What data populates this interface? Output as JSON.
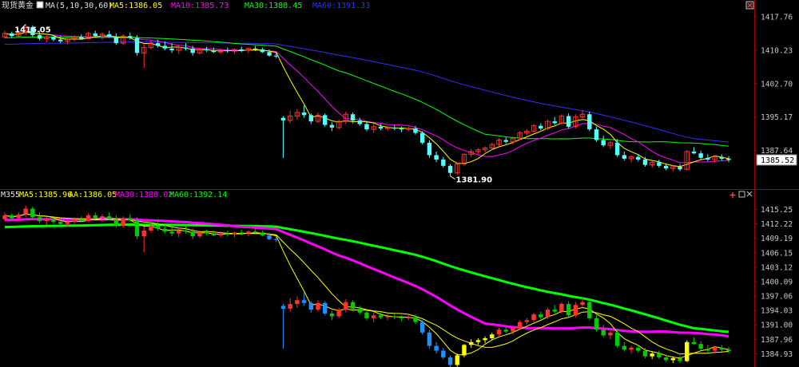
{
  "colors": {
    "background": "#000000",
    "up_candle": "#ff3232",
    "down_candle_top": "#54ffff",
    "down_candle_bottom": "#00cc00",
    "ma5": "#ffff00",
    "ma10": "#ff00ff",
    "ma30": "#00ff00",
    "ma60": "#3030ff",
    "axis_border": "#a00000",
    "axis_text": "#c8c8c8"
  },
  "top_panel": {
    "title": "现货黄金",
    "ma_params": "MA(5,10,30,60)",
    "ma5": "MA5:1386.05",
    "ma10": "MA10:1385.73",
    "ma30": "MA30:1388.45",
    "ma60": "MA60:1391.33",
    "high_annotation": "1416.05",
    "low_annotation": "1381.90",
    "current_price": "1385.52",
    "corner_icon": "close-box-icon"
  },
  "bottom_panel": {
    "indicator_name": "M355",
    "ma5": "MA5:1385.96",
    "aa": "AA:1386.05",
    "ma30": "MA30:1388.02",
    "ma60": "MA60:1392.14",
    "corner_icons": [
      "plus-icon",
      "restore-icon",
      "close-icon"
    ]
  },
  "chart_data": [
    {
      "type": "candlestick",
      "panel": "top",
      "title": "现货黄金",
      "yaxis_ticks": [
        "1417.76",
        "1410.23",
        "1402.70",
        "1395.17",
        "1387.64"
      ],
      "ylim": [
        1379.5,
        1419.0
      ],
      "series": [
        {
          "name": "MA5",
          "value": 1386.05
        },
        {
          "name": "MA10",
          "value": 1385.73
        },
        {
          "name": "MA30",
          "value": 1388.45
        },
        {
          "name": "MA60",
          "value": 1391.33
        }
      ],
      "high": 1416.05,
      "low": 1381.9,
      "last": 1385.52,
      "candles_ohlc": [
        [
          1413.2,
          1414.6,
          1412.8,
          1414.0
        ],
        [
          1414.0,
          1414.4,
          1413.0,
          1413.4
        ],
        [
          1413.4,
          1414.6,
          1413.2,
          1414.2
        ],
        [
          1414.2,
          1416.05,
          1413.6,
          1415.4
        ],
        [
          1415.4,
          1415.8,
          1413.2,
          1413.6
        ],
        [
          1413.6,
          1414.6,
          1412.4,
          1412.8
        ],
        [
          1412.8,
          1413.6,
          1412.0,
          1413.2
        ],
        [
          1413.2,
          1413.6,
          1412.2,
          1412.6
        ],
        [
          1412.6,
          1413.4,
          1411.8,
          1412.2
        ],
        [
          1412.2,
          1413.0,
          1411.6,
          1412.6
        ],
        [
          1412.6,
          1413.6,
          1412.2,
          1413.2
        ],
        [
          1413.2,
          1413.8,
          1412.6,
          1412.8
        ],
        [
          1412.8,
          1414.4,
          1412.6,
          1414.0
        ],
        [
          1414.0,
          1414.6,
          1413.2,
          1413.4
        ],
        [
          1413.4,
          1414.2,
          1412.6,
          1413.8
        ],
        [
          1413.8,
          1414.6,
          1413.0,
          1413.2
        ],
        [
          1413.2,
          1414.0,
          1411.4,
          1411.8
        ],
        [
          1411.8,
          1413.8,
          1411.4,
          1413.4
        ],
        [
          1413.4,
          1414.2,
          1412.6,
          1413.0
        ],
        [
          1413.0,
          1413.6,
          1409.0,
          1409.6
        ],
        [
          1409.6,
          1411.6,
          1406.2,
          1410.8
        ],
        [
          1410.8,
          1412.4,
          1410.4,
          1411.8
        ],
        [
          1411.8,
          1412.6,
          1410.8,
          1411.2
        ],
        [
          1411.2,
          1412.2,
          1410.2,
          1410.6
        ],
        [
          1410.6,
          1411.8,
          1409.6,
          1410.2
        ],
        [
          1410.2,
          1411.4,
          1409.4,
          1410.8
        ],
        [
          1410.8,
          1411.8,
          1410.2,
          1410.6
        ],
        [
          1410.6,
          1411.2,
          1409.0,
          1409.6
        ],
        [
          1409.6,
          1410.8,
          1409.2,
          1410.4
        ],
        [
          1410.4,
          1411.0,
          1409.8,
          1410.2
        ],
        [
          1410.2,
          1410.8,
          1409.6,
          1409.8
        ],
        [
          1409.8,
          1410.6,
          1409.4,
          1410.2
        ],
        [
          1410.2,
          1410.8,
          1409.6,
          1410.0
        ],
        [
          1410.0,
          1410.6,
          1409.4,
          1410.4
        ],
        [
          1410.4,
          1411.0,
          1409.8,
          1410.2
        ],
        [
          1410.2,
          1410.8,
          1409.6,
          1410.6
        ],
        [
          1410.6,
          1411.2,
          1410.0,
          1410.4
        ],
        [
          1410.4,
          1410.8,
          1409.6,
          1409.8
        ],
        [
          1409.8,
          1410.4,
          1408.8,
          1409.0
        ],
        [
          1409.0,
          1409.6,
          1408.4,
          1408.8
        ],
        [
          1395.0,
          1395.4,
          1386.0,
          1394.4
        ],
        [
          1394.4,
          1396.6,
          1393.8,
          1395.4
        ],
        [
          1395.4,
          1397.0,
          1394.6,
          1396.2
        ],
        [
          1396.2,
          1397.8,
          1395.0,
          1395.6
        ],
        [
          1395.6,
          1396.0,
          1393.6,
          1394.2
        ],
        [
          1394.2,
          1396.2,
          1393.8,
          1395.6
        ],
        [
          1395.6,
          1396.0,
          1393.0,
          1393.4
        ],
        [
          1393.4,
          1394.0,
          1392.0,
          1392.8
        ],
        [
          1392.8,
          1394.6,
          1392.4,
          1394.2
        ],
        [
          1394.2,
          1396.4,
          1393.6,
          1395.8
        ],
        [
          1395.8,
          1396.2,
          1393.8,
          1394.4
        ],
        [
          1394.4,
          1395.0,
          1393.2,
          1393.6
        ],
        [
          1393.6,
          1394.2,
          1392.0,
          1392.4
        ],
        [
          1392.4,
          1393.6,
          1391.6,
          1393.0
        ],
        [
          1393.0,
          1393.6,
          1392.2,
          1392.6
        ],
        [
          1392.6,
          1393.2,
          1392.0,
          1392.8
        ],
        [
          1392.8,
          1393.4,
          1392.2,
          1392.6
        ],
        [
          1392.6,
          1393.0,
          1391.8,
          1392.4
        ],
        [
          1392.4,
          1393.0,
          1392.0,
          1392.6
        ],
        [
          1392.6,
          1393.2,
          1391.2,
          1391.6
        ],
        [
          1391.6,
          1392.0,
          1389.0,
          1389.4
        ],
        [
          1389.4,
          1390.0,
          1386.0,
          1386.6
        ],
        [
          1386.6,
          1387.4,
          1385.0,
          1385.6
        ],
        [
          1385.6,
          1386.2,
          1383.8,
          1384.2
        ],
        [
          1384.2,
          1384.6,
          1381.9,
          1382.6
        ],
        [
          1382.6,
          1385.0,
          1382.2,
          1384.6
        ],
        [
          1384.6,
          1387.0,
          1384.2,
          1386.8
        ],
        [
          1386.8,
          1388.0,
          1386.2,
          1387.4
        ],
        [
          1387.4,
          1388.2,
          1386.8,
          1387.8
        ],
        [
          1387.8,
          1388.6,
          1387.2,
          1388.2
        ],
        [
          1388.2,
          1389.4,
          1387.8,
          1389.0
        ],
        [
          1389.0,
          1390.4,
          1388.6,
          1390.0
        ],
        [
          1390.0,
          1390.6,
          1389.2,
          1389.6
        ],
        [
          1389.6,
          1390.8,
          1389.0,
          1390.4
        ],
        [
          1390.4,
          1392.0,
          1390.0,
          1391.6
        ],
        [
          1391.6,
          1392.4,
          1391.0,
          1392.0
        ],
        [
          1392.0,
          1393.6,
          1391.6,
          1393.2
        ],
        [
          1393.2,
          1393.8,
          1392.2,
          1392.6
        ],
        [
          1392.6,
          1394.6,
          1392.2,
          1394.2
        ],
        [
          1394.2,
          1395.2,
          1393.4,
          1393.8
        ],
        [
          1393.8,
          1395.8,
          1393.4,
          1395.4
        ],
        [
          1395.4,
          1396.0,
          1392.6,
          1393.0
        ],
        [
          1393.0,
          1395.8,
          1392.6,
          1395.2
        ],
        [
          1395.2,
          1396.8,
          1394.8,
          1395.8
        ],
        [
          1395.8,
          1396.4,
          1392.0,
          1392.4
        ],
        [
          1392.4,
          1393.0,
          1389.6,
          1390.0
        ],
        [
          1390.0,
          1391.0,
          1388.4,
          1388.8
        ],
        [
          1388.8,
          1389.8,
          1388.0,
          1389.4
        ],
        [
          1389.4,
          1390.2,
          1386.2,
          1386.6
        ],
        [
          1386.6,
          1387.4,
          1385.4,
          1385.8
        ],
        [
          1385.8,
          1386.6,
          1385.0,
          1386.2
        ],
        [
          1386.2,
          1386.8,
          1385.2,
          1385.6
        ],
        [
          1385.6,
          1386.2,
          1384.0,
          1384.4
        ],
        [
          1384.4,
          1385.4,
          1383.8,
          1385.0
        ],
        [
          1385.0,
          1385.6,
          1383.8,
          1384.2
        ],
        [
          1384.2,
          1384.8,
          1383.2,
          1383.6
        ],
        [
          1383.6,
          1384.4,
          1383.0,
          1384.0
        ],
        [
          1384.0,
          1384.6,
          1383.0,
          1383.4
        ],
        [
          1383.4,
          1387.8,
          1383.2,
          1387.4
        ],
        [
          1387.4,
          1388.4,
          1386.8,
          1387.0
        ],
        [
          1387.0,
          1387.6,
          1385.6,
          1386.0
        ],
        [
          1386.0,
          1386.8,
          1385.2,
          1385.6
        ],
        [
          1385.6,
          1386.6,
          1385.0,
          1386.2
        ],
        [
          1386.2,
          1386.8,
          1385.4,
          1385.8
        ],
        [
          1385.8,
          1386.4,
          1385.0,
          1385.52
        ]
      ]
    },
    {
      "type": "candlestick",
      "panel": "bottom",
      "title": "M355",
      "yaxis_ticks": [
        "1415.25",
        "1412.22",
        "1409.19",
        "1406.15",
        "1403.12",
        "1400.09",
        "1397.06",
        "1394.03",
        "1391.00",
        "1387.96",
        "1384.93"
      ],
      "ylim": [
        1382.5,
        1417.0
      ],
      "series": [
        {
          "name": "MA5",
          "value": 1385.96
        },
        {
          "name": "AA",
          "value": 1386.05
        },
        {
          "name": "MA30",
          "value": 1388.02
        },
        {
          "name": "MA60",
          "value": 1392.14
        }
      ]
    }
  ]
}
